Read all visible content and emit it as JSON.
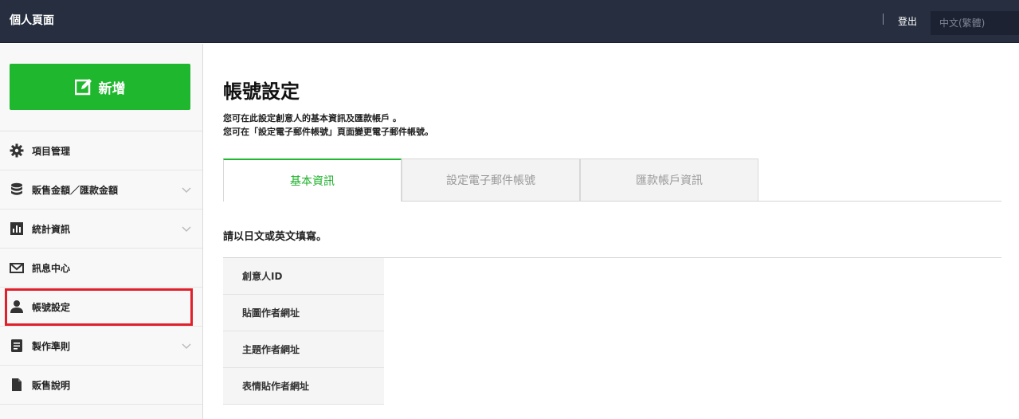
{
  "header": {
    "title": "個人頁面",
    "logout_label": "登出",
    "language_selected": "中文(繁體)"
  },
  "sidebar": {
    "new_button_label": "新增",
    "items": [
      {
        "label": "項目管理",
        "icon": "gear-icon",
        "expandable": false
      },
      {
        "label": "販售金額／匯款金額",
        "icon": "database-icon",
        "expandable": true
      },
      {
        "label": "統計資訊",
        "icon": "bar-chart-icon",
        "expandable": true
      },
      {
        "label": "訊息中心",
        "icon": "envelope-icon",
        "expandable": false
      },
      {
        "label": "帳號設定",
        "icon": "user-icon",
        "expandable": false,
        "highlighted": true
      },
      {
        "label": "製作準則",
        "icon": "document-icon",
        "expandable": true
      },
      {
        "label": "販售說明",
        "icon": "file-icon",
        "expandable": false
      }
    ]
  },
  "main": {
    "title": "帳號設定",
    "description_line1": "您可在此設定創意人的基本資訊及匯款帳戶 。",
    "description_line2": "您可在「設定電子郵件帳號」頁面變更電子郵件帳號。",
    "tabs": [
      {
        "label": "基本資訊",
        "active": true
      },
      {
        "label": "設定電子郵件帳號",
        "active": false
      },
      {
        "label": "匯款帳戶資訊",
        "active": false
      }
    ],
    "section_note": "請以日文或英文填寫。",
    "form_rows": [
      {
        "label": "創意人ID"
      },
      {
        "label": "貼圖作者網址"
      },
      {
        "label": "主題作者網址"
      },
      {
        "label": "表情貼作者網址"
      }
    ]
  },
  "colors": {
    "header_bg": "#262e3f",
    "primary_green": "#1fb72d",
    "highlight_red": "#e0202a"
  }
}
